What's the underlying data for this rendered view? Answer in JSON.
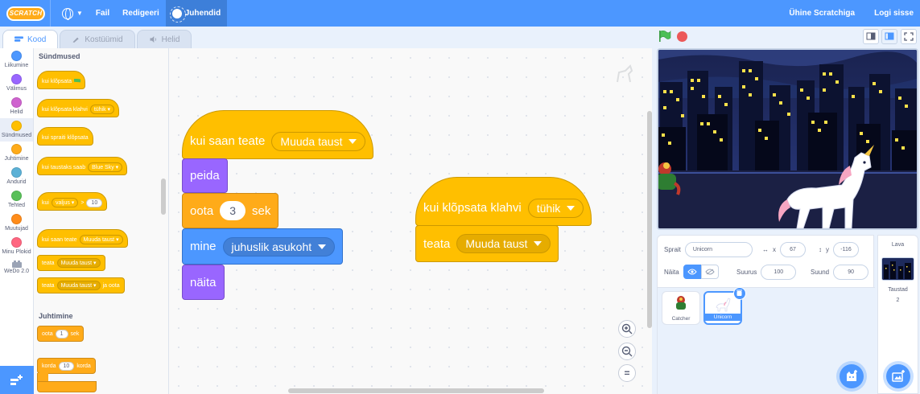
{
  "menu": {
    "logo": "SCRATCH",
    "file": "Fail",
    "edit": "Redigeeri",
    "tutorials": "Juhendid",
    "join": "Ühine Scratchiga",
    "signin": "Logi sisse"
  },
  "tabs": {
    "code": "Kood",
    "costumes": "Kostüümid",
    "sounds": "Helid"
  },
  "categories": [
    {
      "label": "Liikumine",
      "color": "#4c97ff"
    },
    {
      "label": "Välimus",
      "color": "#9966ff"
    },
    {
      "label": "Helid",
      "color": "#cf63cf"
    },
    {
      "label": "Sündmused",
      "color": "#ffbf00"
    },
    {
      "label": "Juhtimine",
      "color": "#ffab19"
    },
    {
      "label": "Andurid",
      "color": "#5cb1d6"
    },
    {
      "label": "Tehted",
      "color": "#59c059"
    },
    {
      "label": "Muutujad",
      "color": "#ff8c1a"
    },
    {
      "label": "Minu Plokid",
      "color": "#ff6680"
    },
    {
      "label": "WeDo 2.0",
      "color": ""
    }
  ],
  "palette": {
    "events_heading": "Sündmused",
    "when_flag": "kui klõpsata",
    "when_key": "kui klõpsata klahvi",
    "when_key_value": "tühik",
    "when_sprite_clicked": "kui spraiti klõpsata",
    "when_backdrop": "kui taustaks saab",
    "when_backdrop_value": "Blue Sky",
    "when_greater": "kui",
    "when_greater_value": "valjus",
    "when_greater_op": ">",
    "when_greater_num": "10",
    "when_receive": "kui saan teate",
    "when_receive_value": "Muuda taust",
    "broadcast": "teata",
    "broadcast_value": "Muuda taust",
    "broadcast_wait": "teata",
    "broadcast_wait_value": "Muuda taust",
    "broadcast_wait_suffix": "ja oota",
    "control_heading": "Juhtimine",
    "wait": "oota",
    "wait_num": "1",
    "wait_unit": "sek",
    "repeat": "korda",
    "repeat_num": "10",
    "repeat_suffix": "korda"
  },
  "script1": {
    "hat": "kui saan teate",
    "hat_value": "Muuda taust",
    "hide": "peida",
    "wait": "oota",
    "wait_num": "3",
    "wait_unit": "sek",
    "goto": "mine",
    "goto_value": "juhuslik asukoht",
    "show": "näita"
  },
  "script2": {
    "hat": "kui klõpsata klahvi",
    "hat_value": "tühik",
    "broadcast": "teata",
    "broadcast_value": "Muuda taust"
  },
  "zoom": {
    "in": "+",
    "out": "−",
    "reset": "="
  },
  "sprite_info": {
    "sprite_label": "Sprait",
    "sprite_name": "Unicorn",
    "x_label": "x",
    "x_value": "67",
    "y_label": "y",
    "y_value": "-116",
    "show_label": "Näita",
    "size_label": "Suurus",
    "size_value": "100",
    "direction_label": "Suund",
    "direction_value": "90"
  },
  "sprites": [
    {
      "name": "Catcher"
    },
    {
      "name": "Unicorn"
    }
  ],
  "stage_pane": {
    "title": "Lava",
    "backdrops_label": "Taustad",
    "backdrops_count": "2"
  }
}
